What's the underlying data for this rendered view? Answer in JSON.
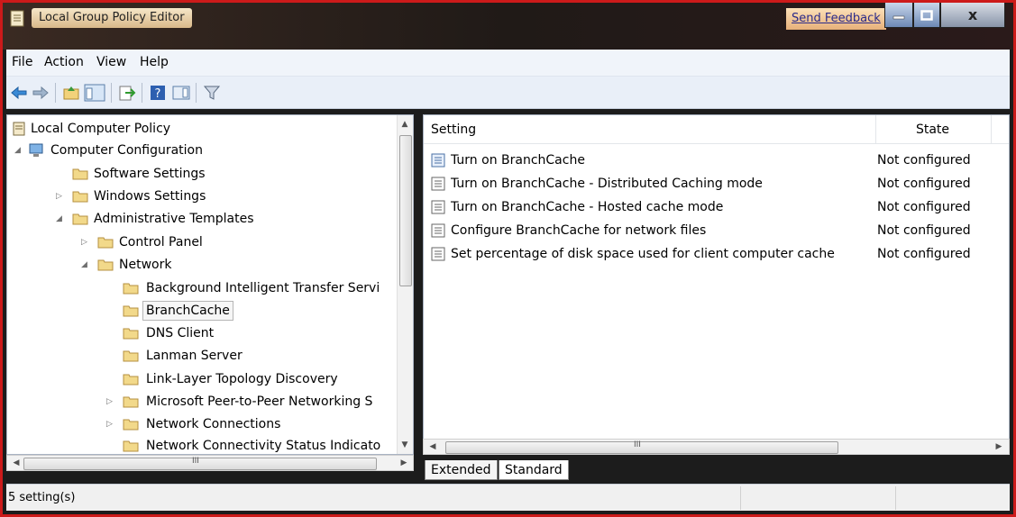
{
  "window": {
    "title": "Local Group Policy Editor",
    "feedback_link": "Send Feedback",
    "close_glyph": "x"
  },
  "menu": {
    "items": [
      "File",
      "Action",
      "View",
      "Help"
    ]
  },
  "toolbar": {
    "buttons": [
      "back-icon",
      "forward-icon",
      "up-folder-icon",
      "show-hide-console-tree-icon",
      "export-list-icon",
      "help-icon",
      "show-hide-action-pane-icon",
      "filter-icon"
    ]
  },
  "tree": {
    "root": "Local Computer Policy",
    "computer_configuration": "Computer Configuration",
    "software_settings": "Software Settings",
    "windows_settings": "Windows Settings",
    "administrative_templates": "Administrative Templates",
    "control_panel": "Control Panel",
    "network": "Network",
    "network_children": [
      "Background Intelligent Transfer Servi",
      "BranchCache",
      "DNS Client",
      "Lanman Server",
      "Link-Layer Topology Discovery",
      "Microsoft Peer-to-Peer Networking S",
      "Network Connections",
      "Network Connectivity Status Indicato"
    ],
    "selected": "BranchCache"
  },
  "list": {
    "columns": {
      "setting": "Setting",
      "state": "State"
    },
    "rows": [
      {
        "setting": "Turn on BranchCache",
        "state": "Not configured"
      },
      {
        "setting": "Turn on BranchCache - Distributed Caching mode",
        "state": "Not configured"
      },
      {
        "setting": "Turn on BranchCache - Hosted cache mode",
        "state": "Not configured"
      },
      {
        "setting": "Configure BranchCache for network files",
        "state": "Not configured"
      },
      {
        "setting": "Set percentage of disk space used for client computer cache",
        "state": "Not configured"
      }
    ]
  },
  "scroll": {
    "thumb_grip": "III"
  },
  "tabs": {
    "extended": "Extended",
    "standard": "Standard",
    "active": "Standard"
  },
  "status": {
    "text": "5 setting(s)"
  },
  "colors": {
    "frame": "#cc1a1a",
    "titlebar": "#201a17",
    "selection_border": "#b5b5b5"
  }
}
